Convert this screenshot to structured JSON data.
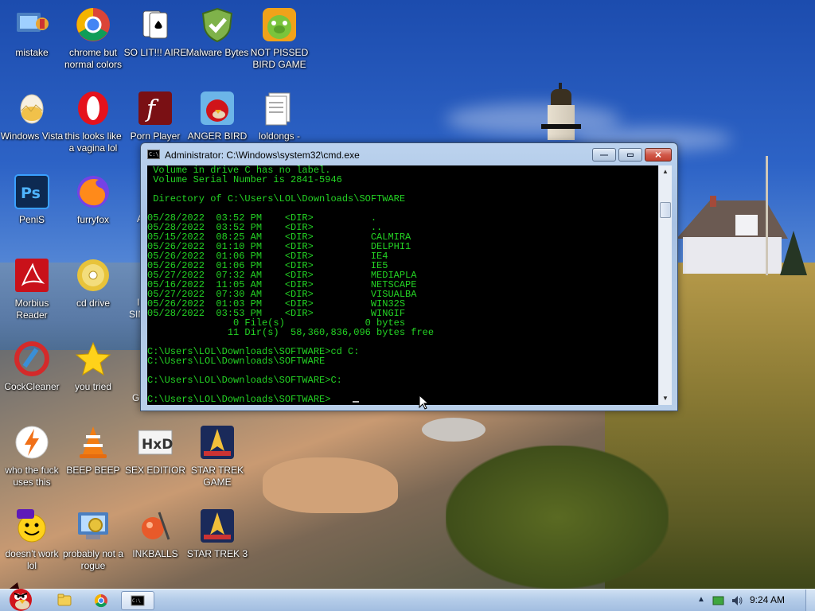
{
  "desktop": {
    "icons": [
      {
        "id": "mistake",
        "label": "mistake",
        "icon": "control-panel-icon"
      },
      {
        "id": "chrome",
        "label": "chrome but normal colors",
        "icon": "chrome-icon"
      },
      {
        "id": "solitaire",
        "label": "SO LIT!!! AIRE",
        "icon": "solitaire-icon"
      },
      {
        "id": "malwarebytes",
        "label": "Malware Bytes",
        "icon": "shield-icon"
      },
      {
        "id": "pissed-bird",
        "label": "NOT PISSED BIRD GAME",
        "icon": "green-pig-icon"
      },
      {
        "id": "windows-vista",
        "label": "Windows Vista",
        "icon": "egg-icon"
      },
      {
        "id": "opera",
        "label": "this looks like a vagina lol",
        "icon": "opera-icon"
      },
      {
        "id": "porn-player",
        "label": "Porn Player",
        "icon": "flash-icon"
      },
      {
        "id": "anger-bird",
        "label": "ANGER BIRD",
        "icon": "angry-bird-icon"
      },
      {
        "id": "loldongs",
        "label": "loldongs -",
        "icon": "document-icon"
      },
      {
        "id": "penis",
        "label": "PeniS",
        "icon": "photoshop-icon"
      },
      {
        "id": "furryfox",
        "label": "furryfox",
        "icon": "firefox-icon"
      },
      {
        "id": "morbius-reader",
        "label": "Morbius Reader",
        "icon": "pdf-reader-icon"
      },
      {
        "id": "cd-drive",
        "label": "cd drive",
        "icon": "cd-icon"
      },
      {
        "id": "cockcleaner",
        "label": "CockCleaner",
        "icon": "ccleaner-icon"
      },
      {
        "id": "you-tried",
        "label": "you tried",
        "icon": "star-icon"
      },
      {
        "id": "who-uses-this",
        "label": "who the fuck uses this",
        "icon": "lightning-icon"
      },
      {
        "id": "beep-beep",
        "label": "BEEP BEEP",
        "icon": "vlc-cone-icon"
      },
      {
        "id": "sex-editior",
        "label": "SEX EDITIOR",
        "icon": "hxd-icon"
      },
      {
        "id": "star-trek-game",
        "label": "STAR TREK GAME",
        "icon": "star-trek-icon"
      },
      {
        "id": "doesnt-work",
        "label": "doesn't work lol",
        "icon": "yahoo-messenger-icon"
      },
      {
        "id": "not-a-rogue",
        "label": "probably not a rogue",
        "icon": "gears-icon"
      },
      {
        "id": "inkballs",
        "label": "INKBALLS",
        "icon": "inkball-icon"
      },
      {
        "id": "star-trek-3",
        "label": "STAR TREK 3",
        "icon": "star-trek-icon"
      }
    ],
    "partial_labels": {
      "a": "A",
      "i": "I",
      "sin": "SIN",
      "g": "G"
    }
  },
  "cmd_window": {
    "title": "Administrator: C:\\Windows\\system32\\cmd.exe",
    "icon_text": "C:\\",
    "minimize_glyph": "—",
    "maximize_glyph": "▭",
    "close_glyph": "✕",
    "lines": [
      " Volume in drive C has no label.",
      " Volume Serial Number is 2841-5946",
      "",
      " Directory of C:\\Users\\LOL\\Downloads\\SOFTWARE",
      "",
      "05/28/2022  03:52 PM    <DIR>          .",
      "05/28/2022  03:52 PM    <DIR>          ..",
      "05/15/2022  08:25 AM    <DIR>          CALMIRA",
      "05/26/2022  01:10 PM    <DIR>          DELPHI1",
      "05/26/2022  01:06 PM    <DIR>          IE4",
      "05/26/2022  01:06 PM    <DIR>          IE5",
      "05/27/2022  07:32 AM    <DIR>          MEDIAPLA",
      "05/16/2022  11:05 AM    <DIR>          NETSCAPE",
      "05/27/2022  07:30 AM    <DIR>          VISUALBA",
      "05/26/2022  01:03 PM    <DIR>          WIN32S",
      "05/28/2022  03:53 PM    <DIR>          WINGIF",
      "               0 File(s)              0 bytes",
      "              11 Dir(s)  58,360,836,096 bytes free",
      "",
      "C:\\Users\\LOL\\Downloads\\SOFTWARE>cd C:",
      "C:\\Users\\LOL\\Downloads\\SOFTWARE",
      "",
      "C:\\Users\\LOL\\Downloads\\SOFTWARE>C:",
      "",
      "C:\\Users\\LOL\\Downloads\\SOFTWARE>"
    ]
  },
  "taskbar": {
    "clock": "9:24 AM",
    "items": [
      "explorer-icon",
      "chrome-icon",
      "cmd-icon"
    ],
    "tray_icons": [
      "show-hidden-icons-arrow",
      "battery-icon",
      "volume-icon"
    ]
  }
}
